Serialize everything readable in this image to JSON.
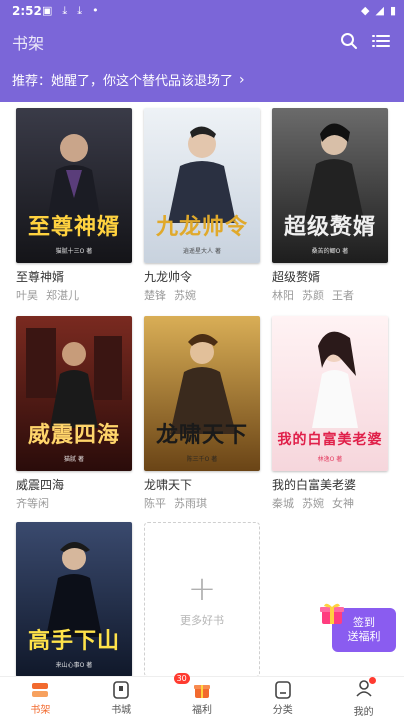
{
  "status": {
    "time": "2:52"
  },
  "appbar": {
    "title": "书架"
  },
  "recommend": {
    "text": "推荐：她醒了，你这个替代品该退场了"
  },
  "books": [
    {
      "title": "至尊神婿",
      "tags": [
        "叶昊",
        "郑湛儿"
      ],
      "cover_text": "至尊神婿",
      "cover_author": "猫腻十三O 著",
      "bg": "#2a2a33",
      "accent": "#ffd23f"
    },
    {
      "title": "九龙帅令",
      "tags": [
        "楚锋",
        "苏婉"
      ],
      "cover_text": "九龙帅令",
      "cover_author": "逍遥星大人 著",
      "bg": "#dfe6ef",
      "accent": "#e0a92b"
    },
    {
      "title": "超级赘婿",
      "tags": [
        "林阳",
        "苏颜",
        "王者"
      ],
      "cover_text": "超级赘婿",
      "cover_author": "桑苦的鲫O 著",
      "bg": "#3a3a3a",
      "accent": "#e8e8e8"
    },
    {
      "title": "威震四海",
      "tags": [
        "齐等闲"
      ],
      "cover_text": "威震四海",
      "cover_author": "猫腻 著",
      "bg": "#5a1a16",
      "accent": "#ffd56b"
    },
    {
      "title": "龙啸天下",
      "tags": [
        "陈平",
        "苏雨琪"
      ],
      "cover_text": "龙啸天下",
      "cover_author": "陈三千O 著",
      "bg": "#b8862f",
      "accent": "#1a1a1a"
    },
    {
      "title": "我的白富美老婆",
      "tags": [
        "秦城",
        "苏婉",
        "女神"
      ],
      "cover_text": "我的白富美老婆",
      "cover_author": "林逸O 著",
      "bg": "#fbe8ec",
      "accent": "#e0204a"
    },
    {
      "title": "高手下山",
      "tags": [],
      "cover_text": "高手下山",
      "cover_author": "来山心事O 著",
      "bg": "#1f2b45",
      "accent": "#ffe34a"
    }
  ],
  "add_more": {
    "label": "更多好书"
  },
  "signin": {
    "line1": "签到",
    "line2": "送福利"
  },
  "tabs": [
    {
      "label": "书架",
      "icon": "bookshelf-icon",
      "active": true
    },
    {
      "label": "书城",
      "icon": "bookstore-icon",
      "active": false
    },
    {
      "label": "福利",
      "icon": "gift-icon",
      "active": false,
      "badge": "30"
    },
    {
      "label": "分类",
      "icon": "category-icon",
      "active": false
    },
    {
      "label": "我的",
      "icon": "profile-icon",
      "active": false
    }
  ],
  "colors": {
    "header": "#7b66d8",
    "active_tab": "#f26a2e",
    "signin": "#8a5cf0"
  }
}
